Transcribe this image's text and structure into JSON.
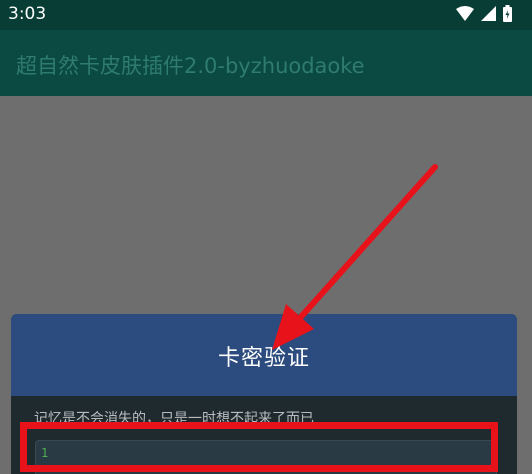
{
  "status_bar": {
    "time": "3:03",
    "icons": [
      "wifi-icon",
      "signal-icon",
      "battery-icon"
    ]
  },
  "app_bar": {
    "title": "超自然卡皮肤插件2.0-byzhuodaoke"
  },
  "dialog": {
    "title": "卡密验证",
    "subtitle": "记忆是不会消失的，只是一时想不起来了而已",
    "input_line_number": "1"
  },
  "colors": {
    "status_bar": "#083d35",
    "app_bar": "#0a4a42",
    "dialog_header": "#2c4b7e",
    "annotation_red": "#e8121b"
  }
}
